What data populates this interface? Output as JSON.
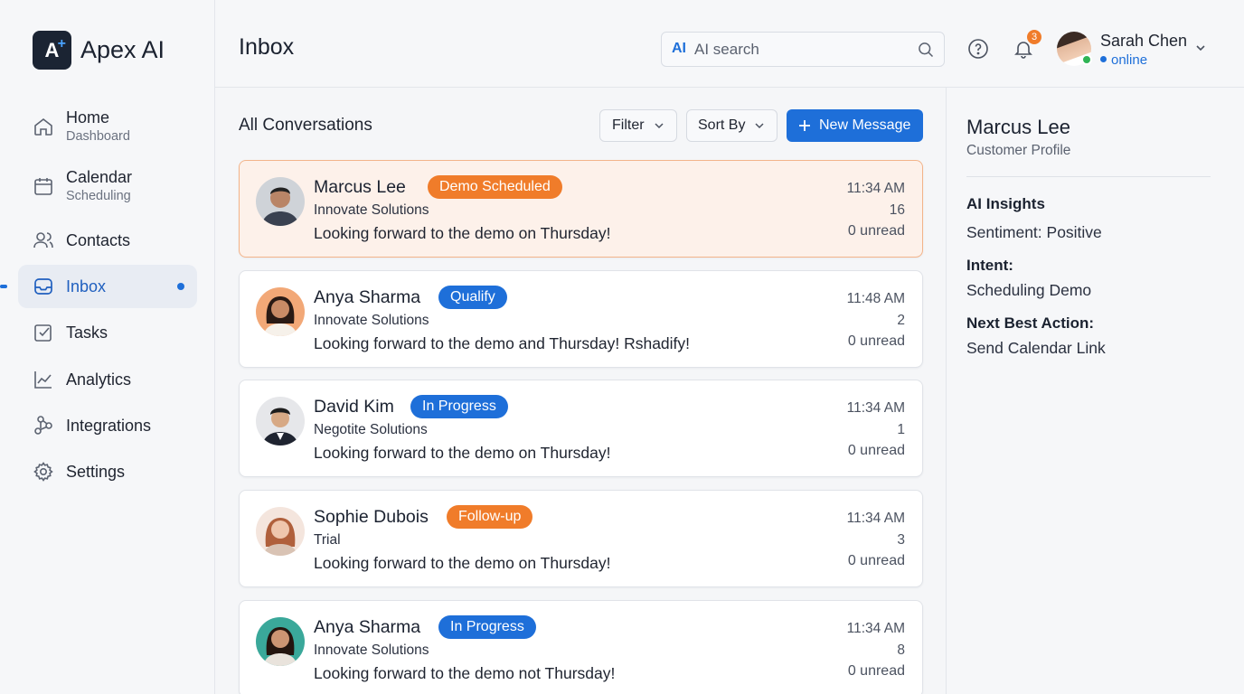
{
  "brand": {
    "logo_text": "A",
    "name": "Apex AI"
  },
  "sidebar": {
    "items": [
      {
        "label": "Home",
        "sub": "Dashboard"
      },
      {
        "label": "Calendar",
        "sub": "Scheduling"
      },
      {
        "label": "Contacts"
      },
      {
        "label": "Inbox",
        "active": true
      },
      {
        "label": "Tasks"
      },
      {
        "label": "Analytics"
      },
      {
        "label": "Integrations"
      },
      {
        "label": "Settings"
      }
    ]
  },
  "header": {
    "title": "Inbox",
    "search": {
      "ai_mark": "AI",
      "placeholder": "AI search"
    },
    "notifications": {
      "count": "3"
    },
    "user": {
      "name": "Sarah Chen",
      "status": "online"
    }
  },
  "list": {
    "title": "All Conversations",
    "filter_label": "Filter",
    "sort_label": "Sort By",
    "new_message_label": "New Message",
    "conversations": [
      {
        "name": "Marcus Lee",
        "badge": "Demo Scheduled",
        "badge_color": "#f07c2a",
        "company": "Innovate Solutions",
        "preview": "Looking forward to the demo on Thursday!",
        "time": "11:34 AM",
        "count": "16",
        "unread": "0 unread",
        "selected": true
      },
      {
        "name": "Anya Sharma",
        "badge": "Qualify",
        "badge_color": "#1e6fd9",
        "company": "Innovate Solutions",
        "preview": "Looking forward to the demo and Thursday! Rshadify!",
        "time": "11:48 AM",
        "count": "2",
        "unread": "0 unread"
      },
      {
        "name": "David Kim",
        "badge": "In Progress",
        "badge_color": "#1e6fd9",
        "company": "Negotite Solutions",
        "preview": "Looking forward to the demo on Thursday!",
        "time": "11:34 AM",
        "count": "1",
        "unread": "0 unread"
      },
      {
        "name": "Sophie Dubois",
        "badge": "Follow-up",
        "badge_color": "#f07c2a",
        "company": "Trial",
        "preview": "Looking forward to the demo on Thursday!",
        "time": "11:34 AM",
        "count": "3",
        "unread": "0 unread"
      },
      {
        "name": "Anya Sharma",
        "badge": "In Progress",
        "badge_color": "#1e6fd9",
        "company": "Innovate Solutions",
        "preview": "Looking forward to the demo not Thursday!",
        "time": "11:34 AM",
        "count": "8",
        "unread": "0 unread"
      }
    ]
  },
  "profile": {
    "name": "Marcus Lee",
    "subtitle": "Customer Profile",
    "insights_title": "AI Insights",
    "sentiment": "Sentiment: Positive",
    "intent_label": "Intent:",
    "intent_value": "Scheduling Demo",
    "nba_label": "Next Best Action:",
    "nba_value": "Send Calendar Link"
  },
  "colors": {
    "accent": "#1e6fd9",
    "orange": "#f07c2a",
    "selected_bg": "#fdf1ea"
  }
}
